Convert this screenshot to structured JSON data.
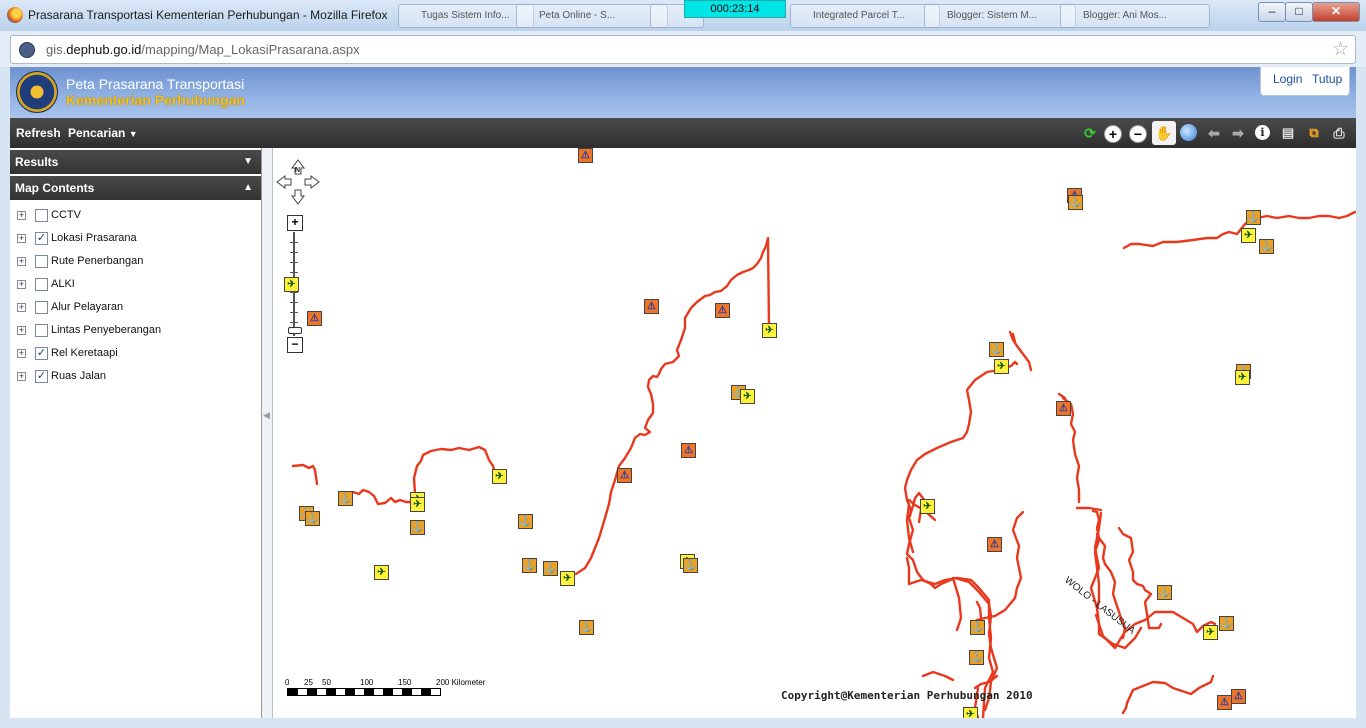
{
  "window": {
    "title": "Prasarana Transportasi Kementerian Perhubungan - Mozilla Firefox",
    "timer": "000:23:14",
    "background_tabs": [
      "Tugas Sistem Info...",
      "Peta Online - S...",
      "",
      "Integrated Parcel T...",
      "Blogger: Sistem M...",
      "Blogger: Ani Mos..."
    ],
    "controls": {
      "minimize": "–",
      "maximize": "□",
      "close": "✕"
    }
  },
  "address_bar": {
    "url_prefix": "gis.",
    "url_domain": "dephub.go.id",
    "url_path": "/mapping/Map_LokasiPrasarana.aspx",
    "bookmark_icon": "star-icon"
  },
  "app": {
    "title_line1": "Peta Prasarana Transportasi",
    "title_line2": "Kementerian Perhubungan",
    "login_label": "Login",
    "close_label": "Tutup"
  },
  "toolbar": {
    "refresh_label": "Refresh",
    "search_label": "Pencarian",
    "search_caret": "▼",
    "tools": [
      "refresh-map-icon",
      "zoom-in-icon",
      "zoom-out-icon",
      "pan-hand-icon",
      "full-extent-globe-icon",
      "previous-extent-icon",
      "next-extent-icon",
      "identify-info-icon",
      "measure-icon",
      "export-icon",
      "print-icon"
    ]
  },
  "panels": {
    "results_label": "Results",
    "results_caret": "▼",
    "map_contents_label": "Map Contents",
    "map_contents_caret": "▲"
  },
  "layers": [
    {
      "label": "CCTV",
      "checked": false
    },
    {
      "label": "Lokasi Prasarana",
      "checked": true
    },
    {
      "label": "Rute Penerbangan",
      "checked": false
    },
    {
      "label": "ALKI",
      "checked": false
    },
    {
      "label": "Alur Pelayaran",
      "checked": false
    },
    {
      "label": "Lintas Penyeberangan",
      "checked": false
    },
    {
      "label": "Rel Keretaapi",
      "checked": true
    },
    {
      "label": "Ruas Jalan",
      "checked": true
    }
  ],
  "map": {
    "copyright": "Copyright@Kementerian Perhubungan 2010",
    "road_label": "WOLO - LASUSUA",
    "scale_labels": [
      "0",
      "25",
      "50",
      "100",
      "150",
      "200 Kilometer"
    ],
    "north_label": "N",
    "zoom_in": "+",
    "zoom_out": "−",
    "colors": {
      "road": "#e8391e",
      "airport": "#fff23a",
      "port": "#f0a020",
      "railway_station": "#ee7528"
    }
  }
}
